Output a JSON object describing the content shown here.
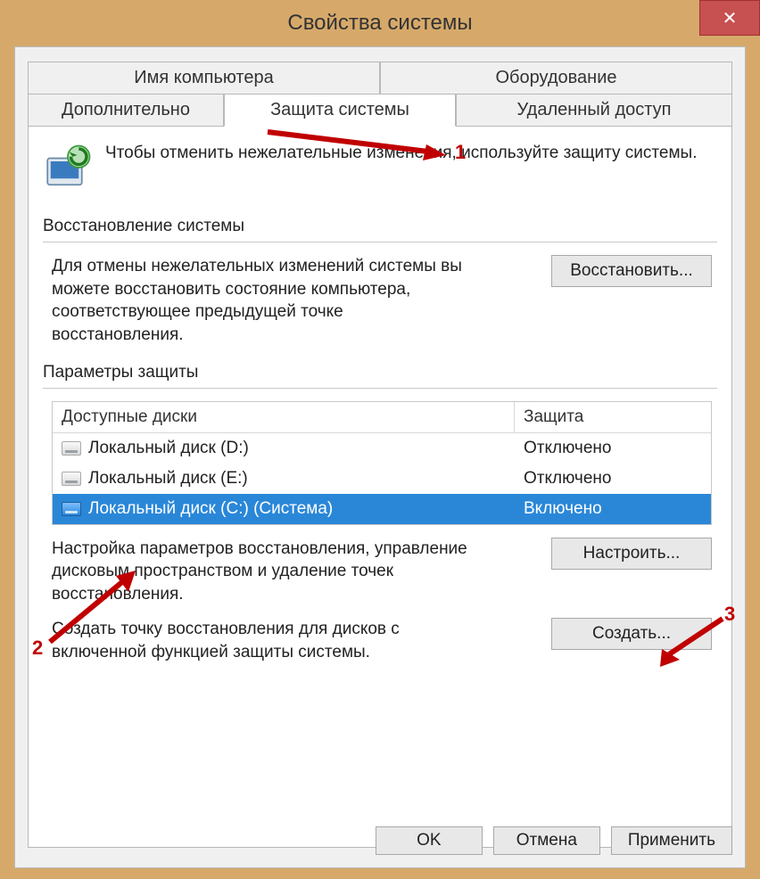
{
  "window_title": "Свойства системы",
  "close_glyph": "✕",
  "tabs_row1": [
    {
      "label": "Имя компьютера"
    },
    {
      "label": "Оборудование"
    }
  ],
  "tabs_row2": [
    {
      "label": "Дополнительно"
    },
    {
      "label": "Защита системы",
      "active": true
    },
    {
      "label": "Удаленный доступ"
    }
  ],
  "intro_text": "Чтобы отменить нежелательные изменения, используйте защиту системы.",
  "restore": {
    "title": "Восстановление системы",
    "desc": "Для отмены нежелательных изменений системы вы можете восстановить состояние компьютера, соответствующее предыдущей точке восстановления.",
    "button": "Восстановить..."
  },
  "protection": {
    "title": "Параметры защиты",
    "col_a": "Доступные диски",
    "col_b": "Защита",
    "rows": [
      {
        "name": "Локальный диск (D:)",
        "status": "Отключено",
        "selected": false,
        "sys": false
      },
      {
        "name": "Локальный диск (E:)",
        "status": "Отключено",
        "selected": false,
        "sys": false
      },
      {
        "name": "Локальный диск (C:) (Система)",
        "status": "Включено",
        "selected": true,
        "sys": true
      }
    ],
    "configure_desc": "Настройка параметров восстановления, управление дисковым пространством и удаление точек восстановления.",
    "configure_btn": "Настроить...",
    "create_desc": "Создать точку восстановления для дисков с включенной функцией защиты системы.",
    "create_btn": "Создать..."
  },
  "dlg": {
    "ok": "OK",
    "cancel": "Отмена",
    "apply": "Применить"
  },
  "annotations": {
    "n1": "1",
    "n2": "2",
    "n3": "3"
  }
}
